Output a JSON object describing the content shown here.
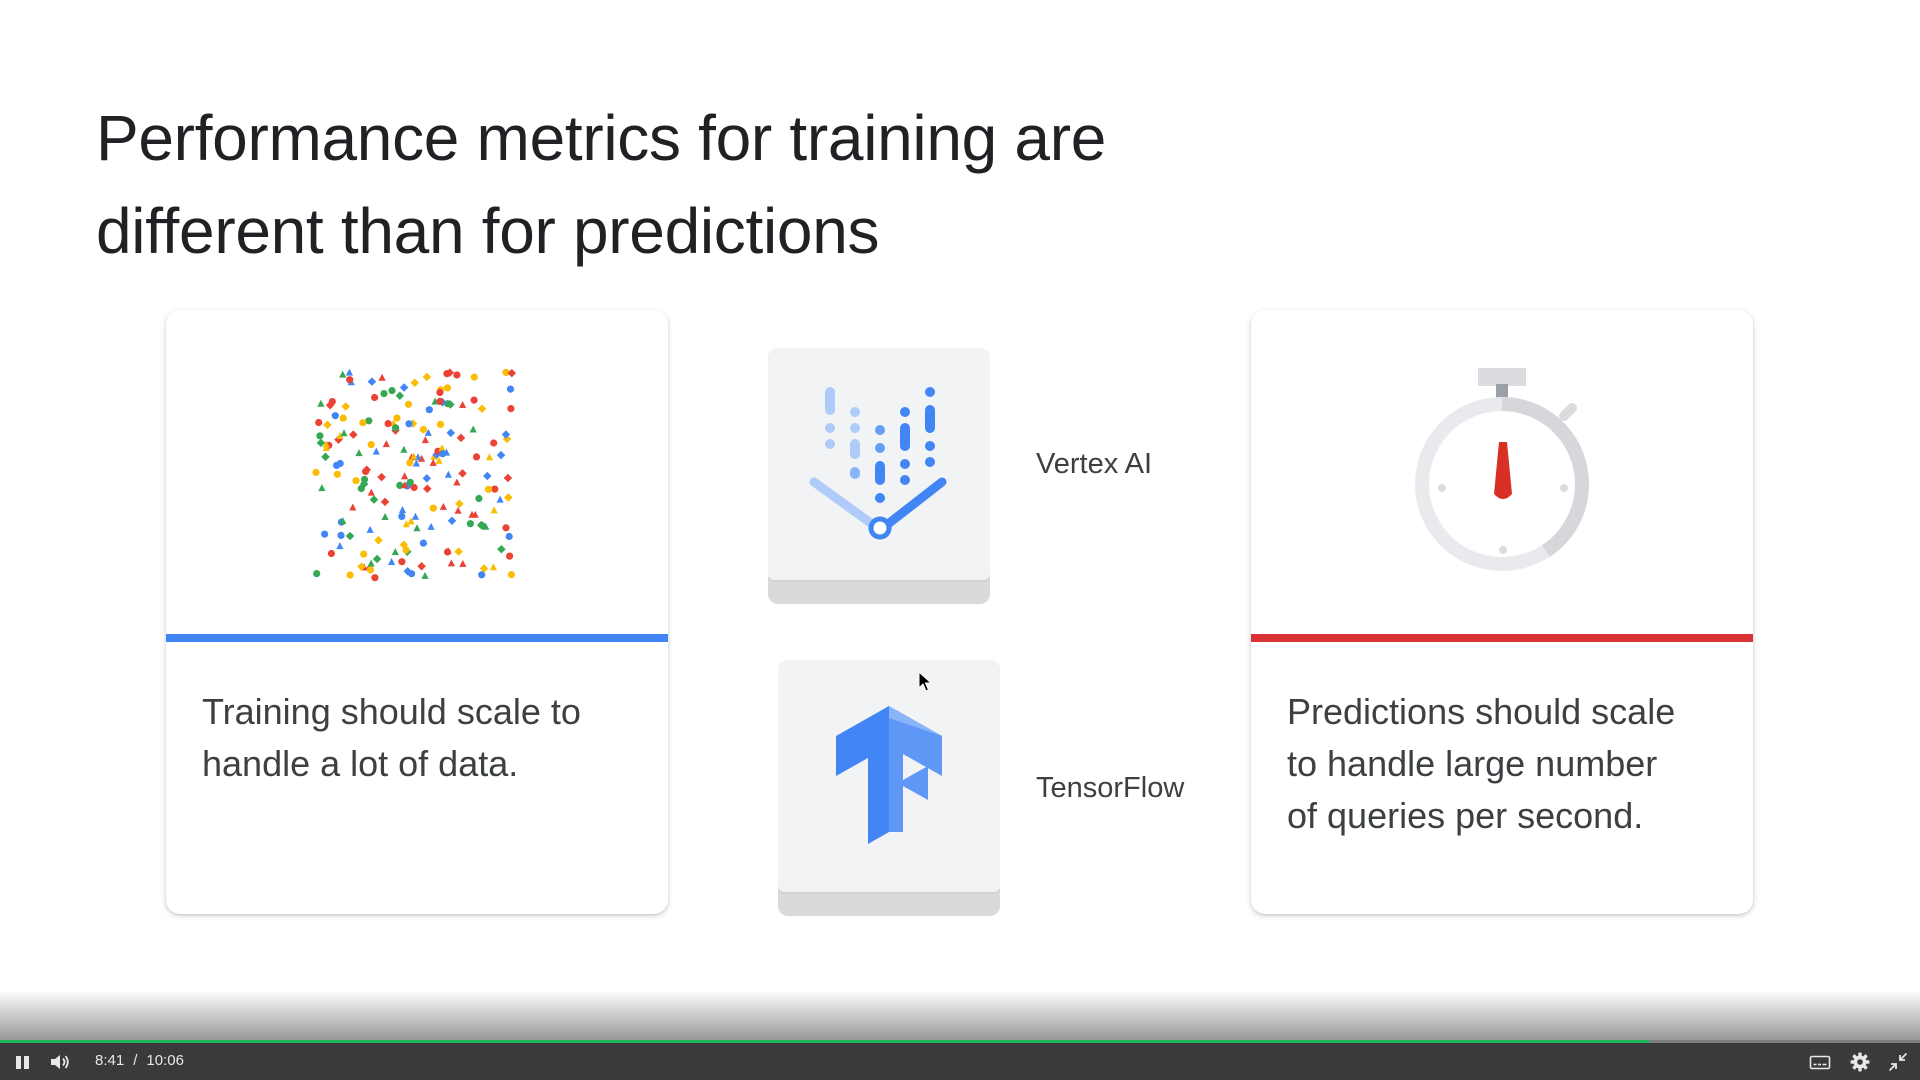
{
  "slide": {
    "title_line1": "Performance metrics for training are",
    "title_line2": "different than for predictions"
  },
  "cards": {
    "training": {
      "text_line1": "Training should scale to",
      "text_line2": "handle a lot of data.",
      "accent_color": "#4285f4",
      "illustration": "scattered-data-points"
    },
    "predictions": {
      "text_line1": "Predictions should scale",
      "text_line2": "to handle large number",
      "text_line3": "of queries per second.",
      "accent_color": "#db3236",
      "illustration": "stopwatch-icon"
    }
  },
  "products": [
    {
      "label": "Vertex AI",
      "icon": "vertex-ai-logo-icon"
    },
    {
      "label": "TensorFlow",
      "icon": "tensorflow-logo-icon"
    }
  ],
  "player": {
    "current_time": "8:41",
    "separator": "/",
    "duration": "10:06",
    "progress_fraction": 0.859,
    "progress_color": "#21b55b",
    "icons": [
      "pause-icon",
      "volume-icon",
      "captions-icon",
      "settings-gear-icon",
      "exit-fullscreen-icon"
    ]
  }
}
